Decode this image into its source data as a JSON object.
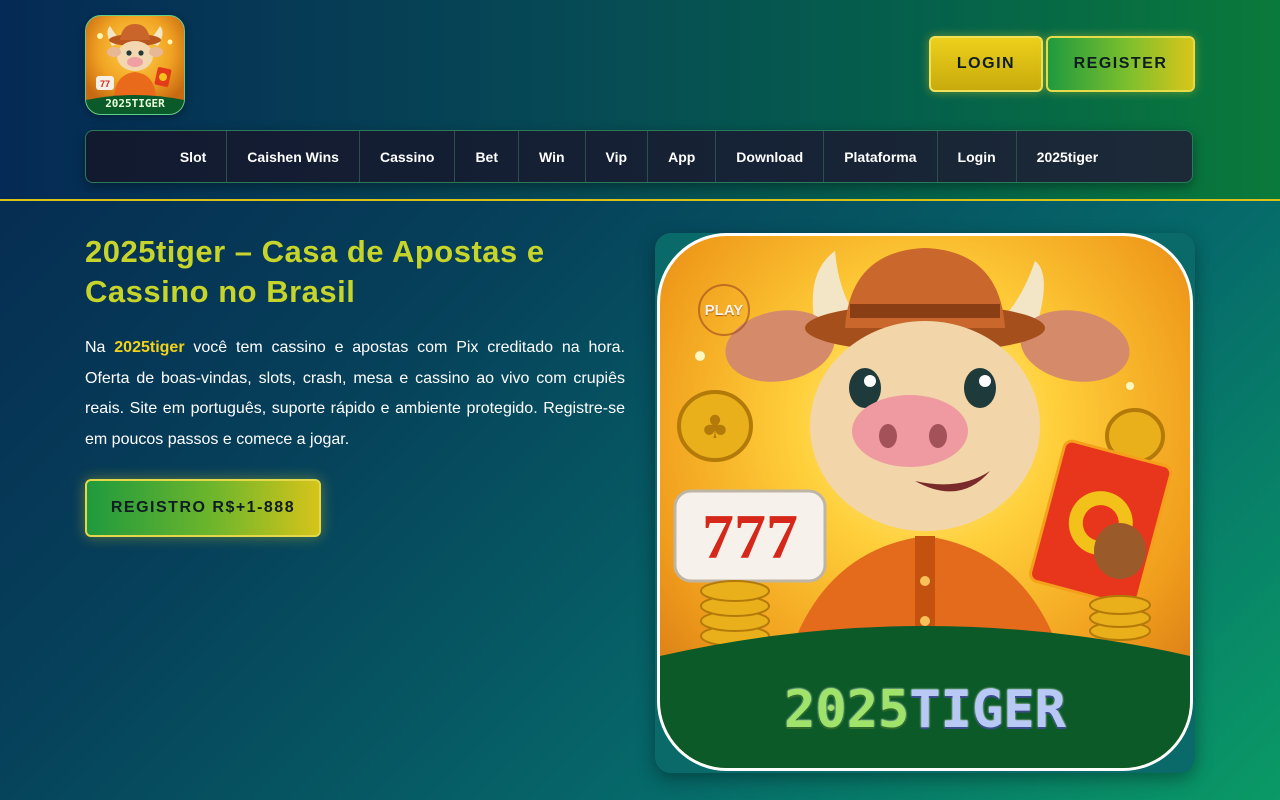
{
  "header": {
    "logo_wordmark": "2025TIGER",
    "login_label": "LOGIN",
    "register_label": "REGISTER"
  },
  "nav": {
    "items": [
      {
        "label": "Slot"
      },
      {
        "label": "Caishen Wins"
      },
      {
        "label": "Cassino"
      },
      {
        "label": "Bet"
      },
      {
        "label": "Win"
      },
      {
        "label": "Vip"
      },
      {
        "label": "App"
      },
      {
        "label": "Download"
      },
      {
        "label": "Plataforma"
      },
      {
        "label": "Login"
      },
      {
        "label": "2025tiger"
      }
    ]
  },
  "hero": {
    "title": "2025tiger – Casa de Apostas e Cassino no Brasil",
    "text_prefix": "Na ",
    "brand": "2025tiger",
    "text_body": " você tem cassino e apostas com Pix creditado na hora. Oferta de boas-vindas, slots, crash, mesa e cassino ao vivo com crupiês reais. Site em português, suporte rápido e ambiente protegido. Registre-se em poucos passos e comece a jogar.",
    "cta_label": "REGISTRO R$+1-888",
    "image": {
      "play_mark": "PLAY",
      "wordmark_part1": "2025",
      "wordmark_part2": "TIGER"
    }
  },
  "colors": {
    "accent_yellow": "#f3d21a",
    "title_green_yellow": "#c7d42a",
    "header_border": "#d8c21a"
  },
  "icons": [
    "logo-mascot-icon",
    "mascot-illustration",
    "play-mark-icon"
  ]
}
